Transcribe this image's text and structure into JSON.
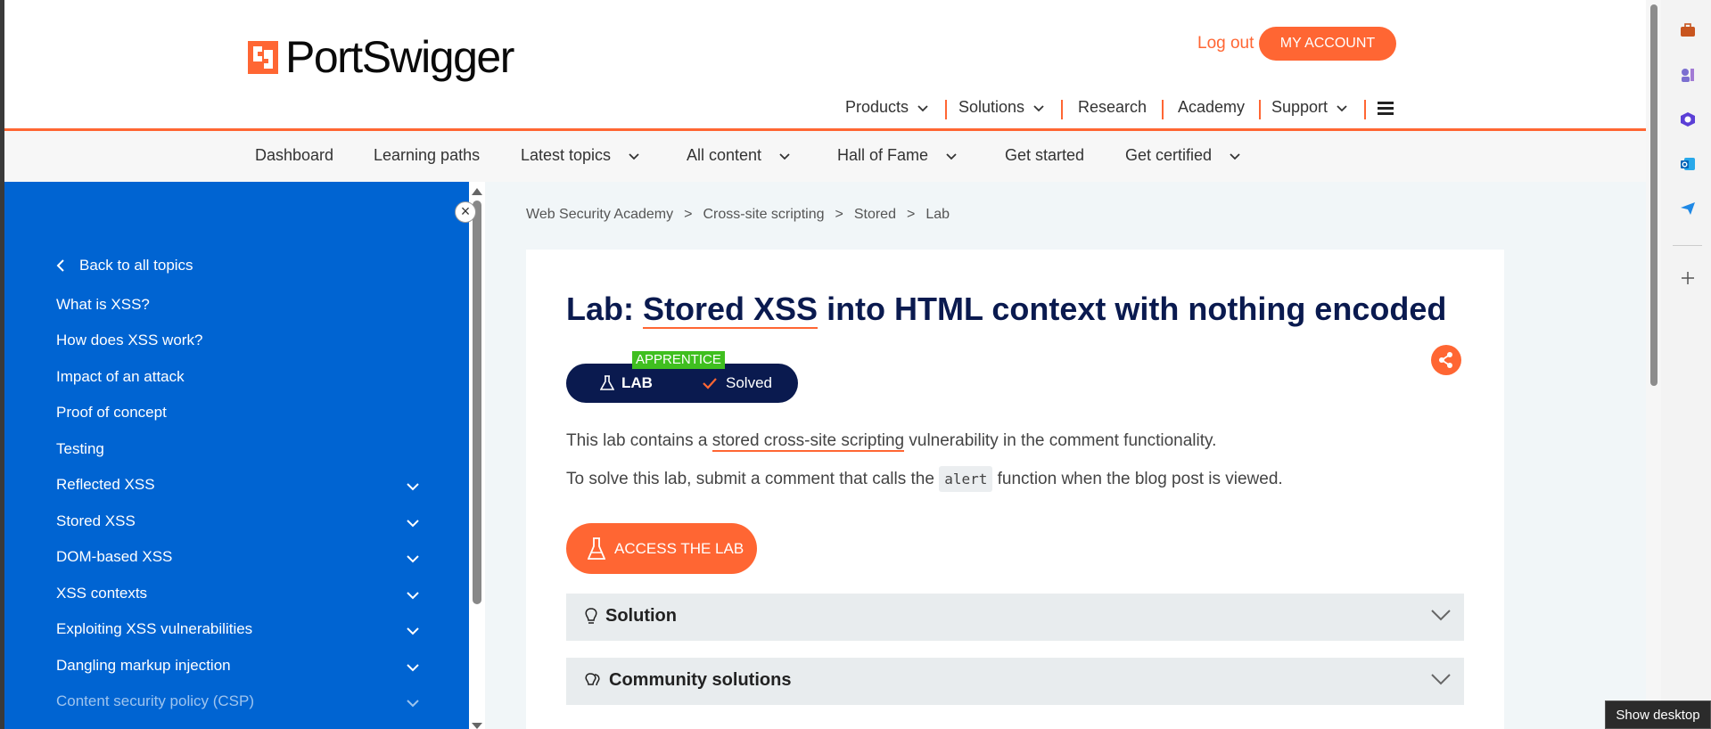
{
  "brand": {
    "name": "PortSwigger",
    "accent": "#ff6633",
    "navy": "#0a1a4f",
    "sidebar_blue": "#0064d2"
  },
  "header": {
    "logout": "Log out",
    "my_account": "MY ACCOUNT",
    "nav": [
      "Products",
      "Solutions",
      "Research",
      "Academy",
      "Support"
    ]
  },
  "subnav": [
    "Dashboard",
    "Learning paths",
    "Latest topics",
    "All content",
    "Hall of Fame",
    "Get started",
    "Get certified"
  ],
  "sidebar": {
    "back": "Back to all topics",
    "items": [
      "What is XSS?",
      "How does XSS work?",
      "Impact of an attack",
      "Proof of concept",
      "Testing",
      "Reflected XSS",
      "Stored XSS",
      "DOM-based XSS",
      "XSS contexts",
      "Exploiting XSS vulnerabilities",
      "Dangling markup injection",
      "Content security policy (CSP)"
    ]
  },
  "breadcrumb": [
    "Web Security Academy",
    ">",
    "Cross-site scripting",
    ">",
    "Stored",
    ">",
    "Lab"
  ],
  "lab": {
    "title_prefix": "Lab: ",
    "title_link": "Stored XSS",
    "title_suffix": " into HTML context with nothing encoded",
    "level": "APPRENTICE",
    "type": "LAB",
    "status": "Solved",
    "desc1_a": "This lab contains a ",
    "desc1_link": "stored cross-site scripting",
    "desc1_b": " vulnerability in the comment functionality.",
    "desc2_a": "To solve this lab, submit a comment that calls the ",
    "desc2_code": "alert",
    "desc2_b": " function when the blog post is viewed.",
    "access_button": "ACCESS THE LAB",
    "solution": "Solution",
    "community": "Community solutions"
  },
  "taskbar": {
    "tooltip": "Show desktop"
  }
}
